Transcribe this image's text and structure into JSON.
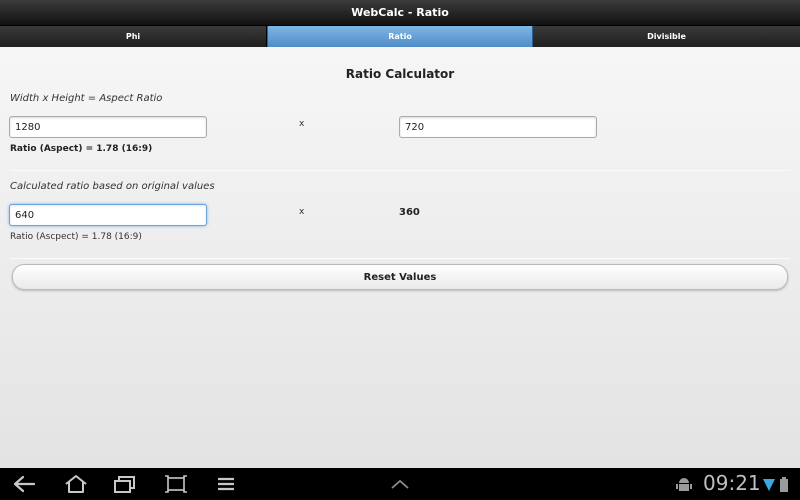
{
  "app": {
    "title": "WebCalc - Ratio"
  },
  "tabs": [
    {
      "label": "Phi",
      "active": false
    },
    {
      "label": "Ratio",
      "active": true
    },
    {
      "label": "Divisible",
      "active": false
    }
  ],
  "main": {
    "title": "Ratio Calculator",
    "section1": {
      "label": "Width x Height = Aspect Ratio",
      "width_value": "1280",
      "height_value": "720",
      "x_sign": "x",
      "result": "Ratio (Aspect) = 1.78 (16:9)"
    },
    "section2": {
      "label": "Calculated ratio based on original values",
      "width_value": "640",
      "x_sign": "x",
      "height_value": "360",
      "result": "Ratio (Ascpect) = 1.78 (16:9)"
    },
    "reset_label": "Reset Values"
  },
  "system_bar": {
    "time": "09:21",
    "icons": [
      "back-icon",
      "home-icon",
      "recent-apps-icon",
      "screenshot-icon",
      "menu-icon",
      "up-chevron-icon",
      "android-icon",
      "wifi-icon",
      "battery-icon"
    ]
  },
  "colors": {
    "active_tab": "#5f9bd3",
    "header_bg": "#222222",
    "content_bg": "#ebebeb",
    "focus_border": "#6fa3d6"
  }
}
